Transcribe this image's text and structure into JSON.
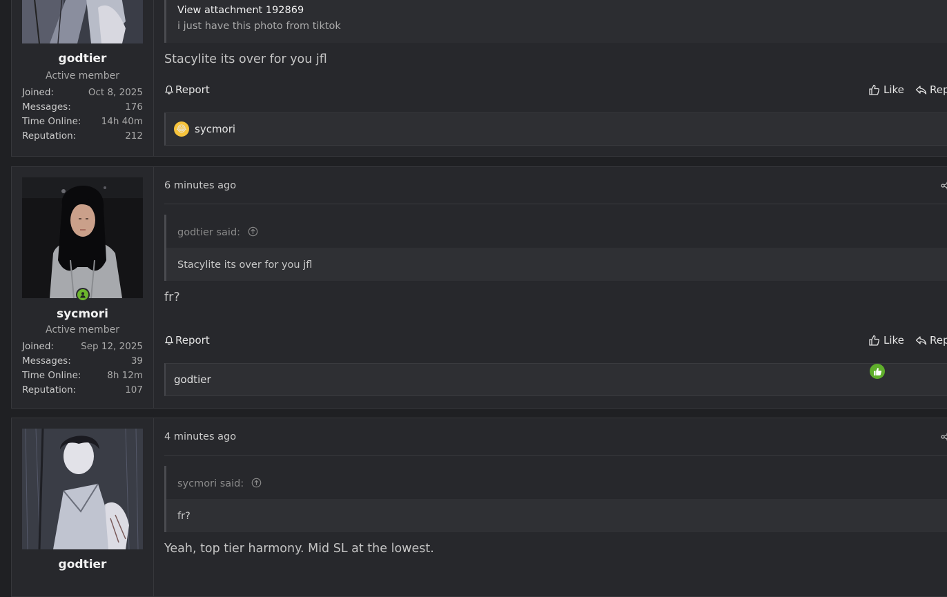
{
  "posts": [
    {
      "username": "godtier",
      "user_title": "Active member",
      "stats": [
        {
          "label": "Joined:",
          "value": "Oct 8, 2025"
        },
        {
          "label": "Messages:",
          "value": "176"
        },
        {
          "label": "Time Online:",
          "value": "14h 40m"
        },
        {
          "label": "Reputation:",
          "value": "212"
        }
      ],
      "quote_head": "View attachment 192869",
      "quote_body": "i just have this photo from tiktok",
      "body": "Stacylite its over for you jfl",
      "report_label": "Report",
      "like_label": "Like",
      "reply_label": "Rep",
      "reaction_user": "sycmori",
      "reaction_icon": "laughing-emoji-icon"
    },
    {
      "username": "sycmori",
      "user_title": "Active member",
      "stats": [
        {
          "label": "Joined:",
          "value": "Sep 12, 2025"
        },
        {
          "label": "Messages:",
          "value": "39"
        },
        {
          "label": "Time Online:",
          "value": "8h 12m"
        },
        {
          "label": "Reputation:",
          "value": "107"
        }
      ],
      "timestamp": "6 minutes ago",
      "quote_author": "godtier said:",
      "quote_body": "Stacylite its over for you jfl",
      "body": "fr?",
      "report_label": "Report",
      "like_label": "Like",
      "reply_label": "Rep",
      "reaction_user": "godtier",
      "reaction_icon": "thumbs-up-reaction-icon"
    },
    {
      "username": "godtier",
      "timestamp": "4 minutes ago",
      "quote_author": "sycmori said:",
      "quote_body": "fr?",
      "body": "Yeah, top tier harmony. Mid SL at the lowest."
    }
  ],
  "colors": {
    "background": "#1f2023",
    "panel": "#27282c",
    "online": "#6cb52d",
    "like_reaction": "#5fae2b",
    "laugh_reaction": "#f6c33c"
  }
}
